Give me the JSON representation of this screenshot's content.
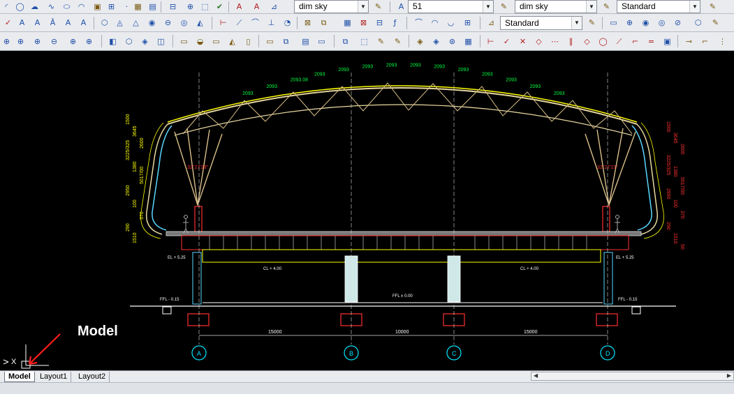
{
  "toolbar": {
    "row1": {
      "dimstyle_combo": "dim sky",
      "layer_combo": "51",
      "textstyle_combo": "dim sky",
      "tablestyle_combo": "Standard"
    },
    "row2": {
      "dimstyle_combo": "Standard"
    }
  },
  "tabs": {
    "items": [
      {
        "label": "Model"
      },
      {
        "label": "Layout1"
      },
      {
        "label": "Layout2"
      }
    ]
  },
  "annotation": {
    "label": "Model"
  },
  "ucs": {
    "x_label": "X"
  },
  "drawing": {
    "top_dims": [
      "2093",
      "2093",
      "2093.08",
      "2093",
      "2093",
      "2093",
      "2093",
      "2093",
      "2093",
      "2093",
      "2093",
      "2093",
      "2093",
      "2093"
    ],
    "left_dims": [
      "1500",
      "3645",
      "2600",
      "3225/325",
      "1380",
      "5017/00",
      "2950",
      "100",
      "370",
      "290",
      "1510"
    ],
    "right_dims": [
      "1500",
      "3645",
      "2600",
      "3225/325",
      "1380",
      "5017/00",
      "2950",
      "100",
      "370",
      "290",
      "1510",
      "50"
    ],
    "angle_labels": [
      "32°27'29\"",
      "32°27'21\""
    ],
    "level_labels": [
      "EL + 5.25",
      "CL + 4.00",
      "CL + 4.00",
      "EL + 5.25",
      "FFL - 0.15",
      "FFL ± 0.00",
      "FFL - 0.15"
    ],
    "span_dims": [
      "15000",
      "10000",
      "15000"
    ],
    "grid_labels": [
      "A",
      "B",
      "C",
      "D"
    ]
  }
}
